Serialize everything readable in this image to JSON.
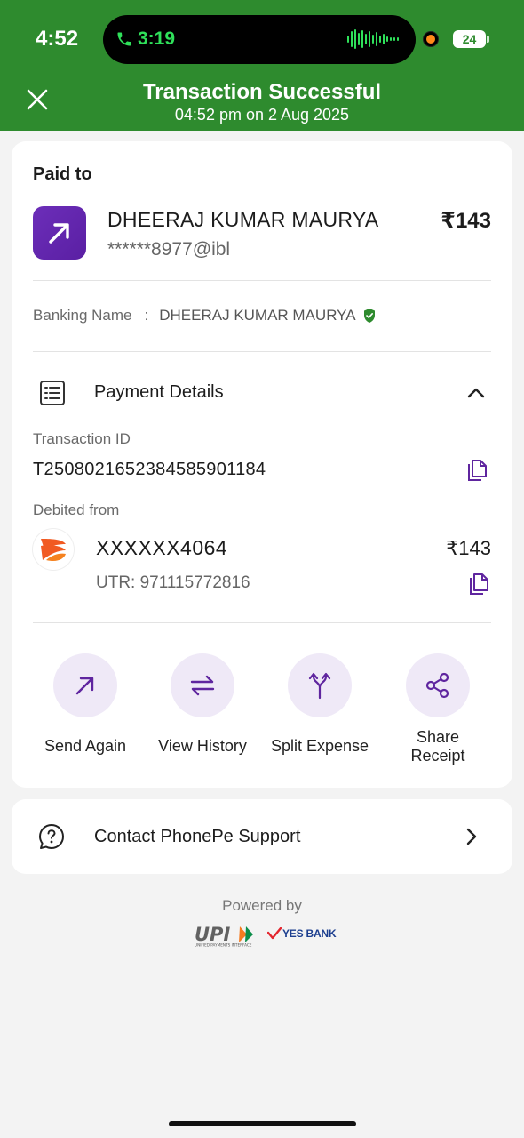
{
  "status_bar": {
    "time": "4:52",
    "call_time": "3:19",
    "battery": "24"
  },
  "header": {
    "title": "Transaction Successful",
    "subtitle": "04:52 pm on 2 Aug 2025"
  },
  "payee": {
    "section_label": "Paid to",
    "name": "DHEERAJ KUMAR MAURYA",
    "upi_id": "******8977@ibl",
    "amount": "₹143",
    "banking_label": "Banking Name",
    "banking_sep": ":",
    "banking_name": "DHEERAJ KUMAR MAURYA"
  },
  "payment_details": {
    "label": "Payment Details",
    "txid_label": "Transaction ID",
    "txid": "T2508021652384585901184",
    "debited_label": "Debited from",
    "account": "XXXXXX4064",
    "utr": "UTR: 971115772816",
    "amount": "₹143"
  },
  "actions": [
    {
      "label": "Send Again",
      "icon": "arrow-up-right-icon"
    },
    {
      "label": "View History",
      "icon": "swap-arrows-icon"
    },
    {
      "label": "Split Expense",
      "icon": "split-icon"
    },
    {
      "label": "Share Receipt",
      "icon": "share-icon"
    }
  ],
  "support": {
    "label": "Contact PhonePe Support"
  },
  "footer": {
    "powered_by": "Powered by",
    "upi_tagline": "UNIFIED PAYMENTS INTERFACE",
    "bank": "YES BANK"
  },
  "colors": {
    "header_green": "#2e8b2e",
    "accent_purple": "#5f259f",
    "action_bg": "#efe9f7"
  }
}
